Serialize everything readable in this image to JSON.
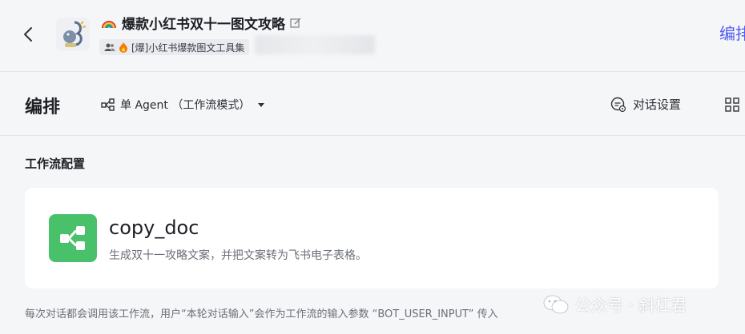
{
  "header": {
    "bot_title": "爆款小红书双十一图文攻略",
    "workspace_label": "[爆]小红书爆款图文工具集",
    "mode_link": "编排"
  },
  "subbar": {
    "title": "编排",
    "agent_mode": "单 Agent （工作流模式）",
    "dialog_settings": "对话设置"
  },
  "content": {
    "section_title": "工作流配置",
    "workflow": {
      "name": "copy_doc",
      "description": "生成双十一攻略文案，并把文案转为飞书电子表格。"
    },
    "note": "每次对话都会调用该工作流，用户“本轮对话输入”会作为工作流的输入参数 “BOT_USER_INPUT” 传入"
  },
  "watermark": "公众号 · 斜杠君",
  "colors": {
    "accent": "#4e5bf0",
    "workflow_icon_bg": "#48c16a"
  },
  "icons": [
    "back-arrow-icon",
    "bot-avatar-icon",
    "rainbow-icon",
    "edit-icon",
    "group-icon",
    "fire-icon",
    "agent-mode-icon",
    "dialog-settings-icon",
    "grid-icon",
    "workflow-icon",
    "wechat-icon"
  ]
}
